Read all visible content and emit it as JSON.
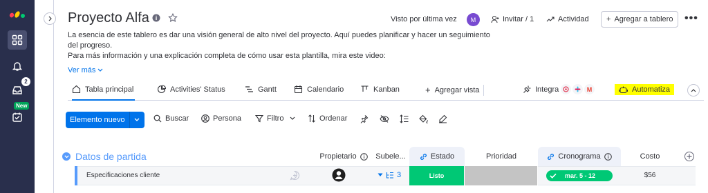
{
  "header": {
    "title": "Proyecto Alfa",
    "last_seen_label": "Visto por última vez",
    "avatar_initial": "M",
    "invite_label": "Invitar / 1",
    "activity_label": "Actividad",
    "add_board_label": "Agregar a tablero"
  },
  "rail": {
    "inbox_count": "2",
    "new_badge": "New"
  },
  "description": {
    "line1": "La esencia de este tablero es dar una visión general de alto nivel del proyecto. Aquí puedes planificar y hacer un seguimiento del progreso.",
    "line2": "Para más información y una explicación completa de cómo usar esta plantilla, mira este video:",
    "see_more": "Ver más"
  },
  "tabs": [
    {
      "label": "Tabla principal",
      "icon": "home-icon",
      "active": true
    },
    {
      "label": "Activities' Status",
      "icon": "pie-chart-icon"
    },
    {
      "label": "Gantt",
      "icon": "gantt-icon"
    },
    {
      "label": "Calendario",
      "icon": "calendar-icon"
    },
    {
      "label": "Kanban",
      "icon": "kanban-icon"
    },
    {
      "label": "Agregar vista",
      "icon": "plus-icon"
    }
  ],
  "integrations": {
    "label": "Integra"
  },
  "automate": {
    "label": "Automatiza",
    "highlight_color": "#ffff00"
  },
  "toolbar": {
    "new_item": "Elemento nuevo",
    "search": "Buscar",
    "person": "Persona",
    "filter": "Filtro",
    "sort": "Ordenar"
  },
  "group": {
    "title": "Datos de partida",
    "color": "#579bfc"
  },
  "columns": {
    "owner": "Propietario",
    "subitems": "Subele...",
    "status": "Estado",
    "priority": "Prioridad",
    "timeline": "Cronograma",
    "cost": "Costo"
  },
  "rows": [
    {
      "name": "Especificaciones cliente",
      "subitems_count": "3",
      "status": "Listo",
      "status_color": "#00c875",
      "priority_color": "#c4c4c4",
      "timeline": "mar. 5 - 12",
      "cost": "$56"
    }
  ],
  "colors": {
    "accent": "#0073ea",
    "rail": "#292f4c",
    "done_green": "#00c875"
  }
}
